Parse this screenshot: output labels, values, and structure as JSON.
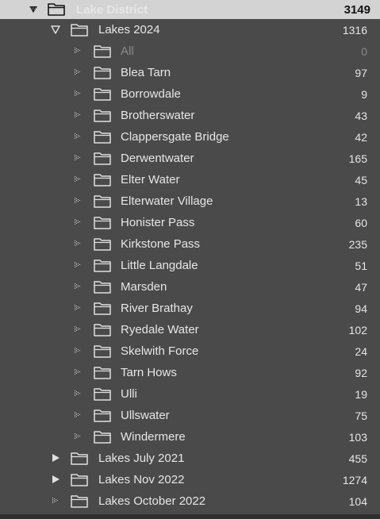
{
  "root": {
    "label": "Lake District",
    "count": "3149",
    "toggle_icon": "triangle-down-icon",
    "folder_icon": "folder-icon"
  },
  "collections": [
    {
      "label": "Lakes 2024",
      "count": "1316",
      "expanded": true,
      "toggle_icon": "triangle-down-icon",
      "children": [
        {
          "label": "All",
          "count": "0",
          "dimmed": true
        },
        {
          "label": "Blea Tarn",
          "count": "97"
        },
        {
          "label": "Borrowdale",
          "count": "9"
        },
        {
          "label": "Brotherswater",
          "count": "43"
        },
        {
          "label": "Clappersgate Bridge",
          "count": "42"
        },
        {
          "label": "Derwentwater",
          "count": "165"
        },
        {
          "label": "Elter Water",
          "count": "45"
        },
        {
          "label": "Elterwater Village",
          "count": "13"
        },
        {
          "label": "Honister Pass",
          "count": "60"
        },
        {
          "label": "Kirkstone Pass",
          "count": "235"
        },
        {
          "label": "Little Langdale",
          "count": "51"
        },
        {
          "label": "Marsden",
          "count": "47"
        },
        {
          "label": "River Brathay",
          "count": "94"
        },
        {
          "label": "Ryedale Water",
          "count": "102"
        },
        {
          "label": "Skelwith Force",
          "count": "24"
        },
        {
          "label": "Tarn Hows",
          "count": "92"
        },
        {
          "label": "Ulli",
          "count": "19"
        },
        {
          "label": "Ullswater",
          "count": "75"
        },
        {
          "label": "Windermere",
          "count": "103"
        }
      ]
    },
    {
      "label": "Lakes July 2021",
      "count": "455",
      "expanded": false,
      "toggle_icon": "triangle-right-icon"
    },
    {
      "label": "Lakes Nov 2022",
      "count": "1274",
      "expanded": false,
      "toggle_icon": "triangle-right-icon"
    },
    {
      "label": "Lakes October 2022",
      "count": "104",
      "expanded": false,
      "toggle_icon": "dotted-triangle-icon"
    }
  ],
  "colors": {
    "panel_background": "#4a4a4a",
    "selected_row": "#d3d3d3",
    "text": "#e6e6e6",
    "dimmed_text": "#8a8a8a"
  }
}
